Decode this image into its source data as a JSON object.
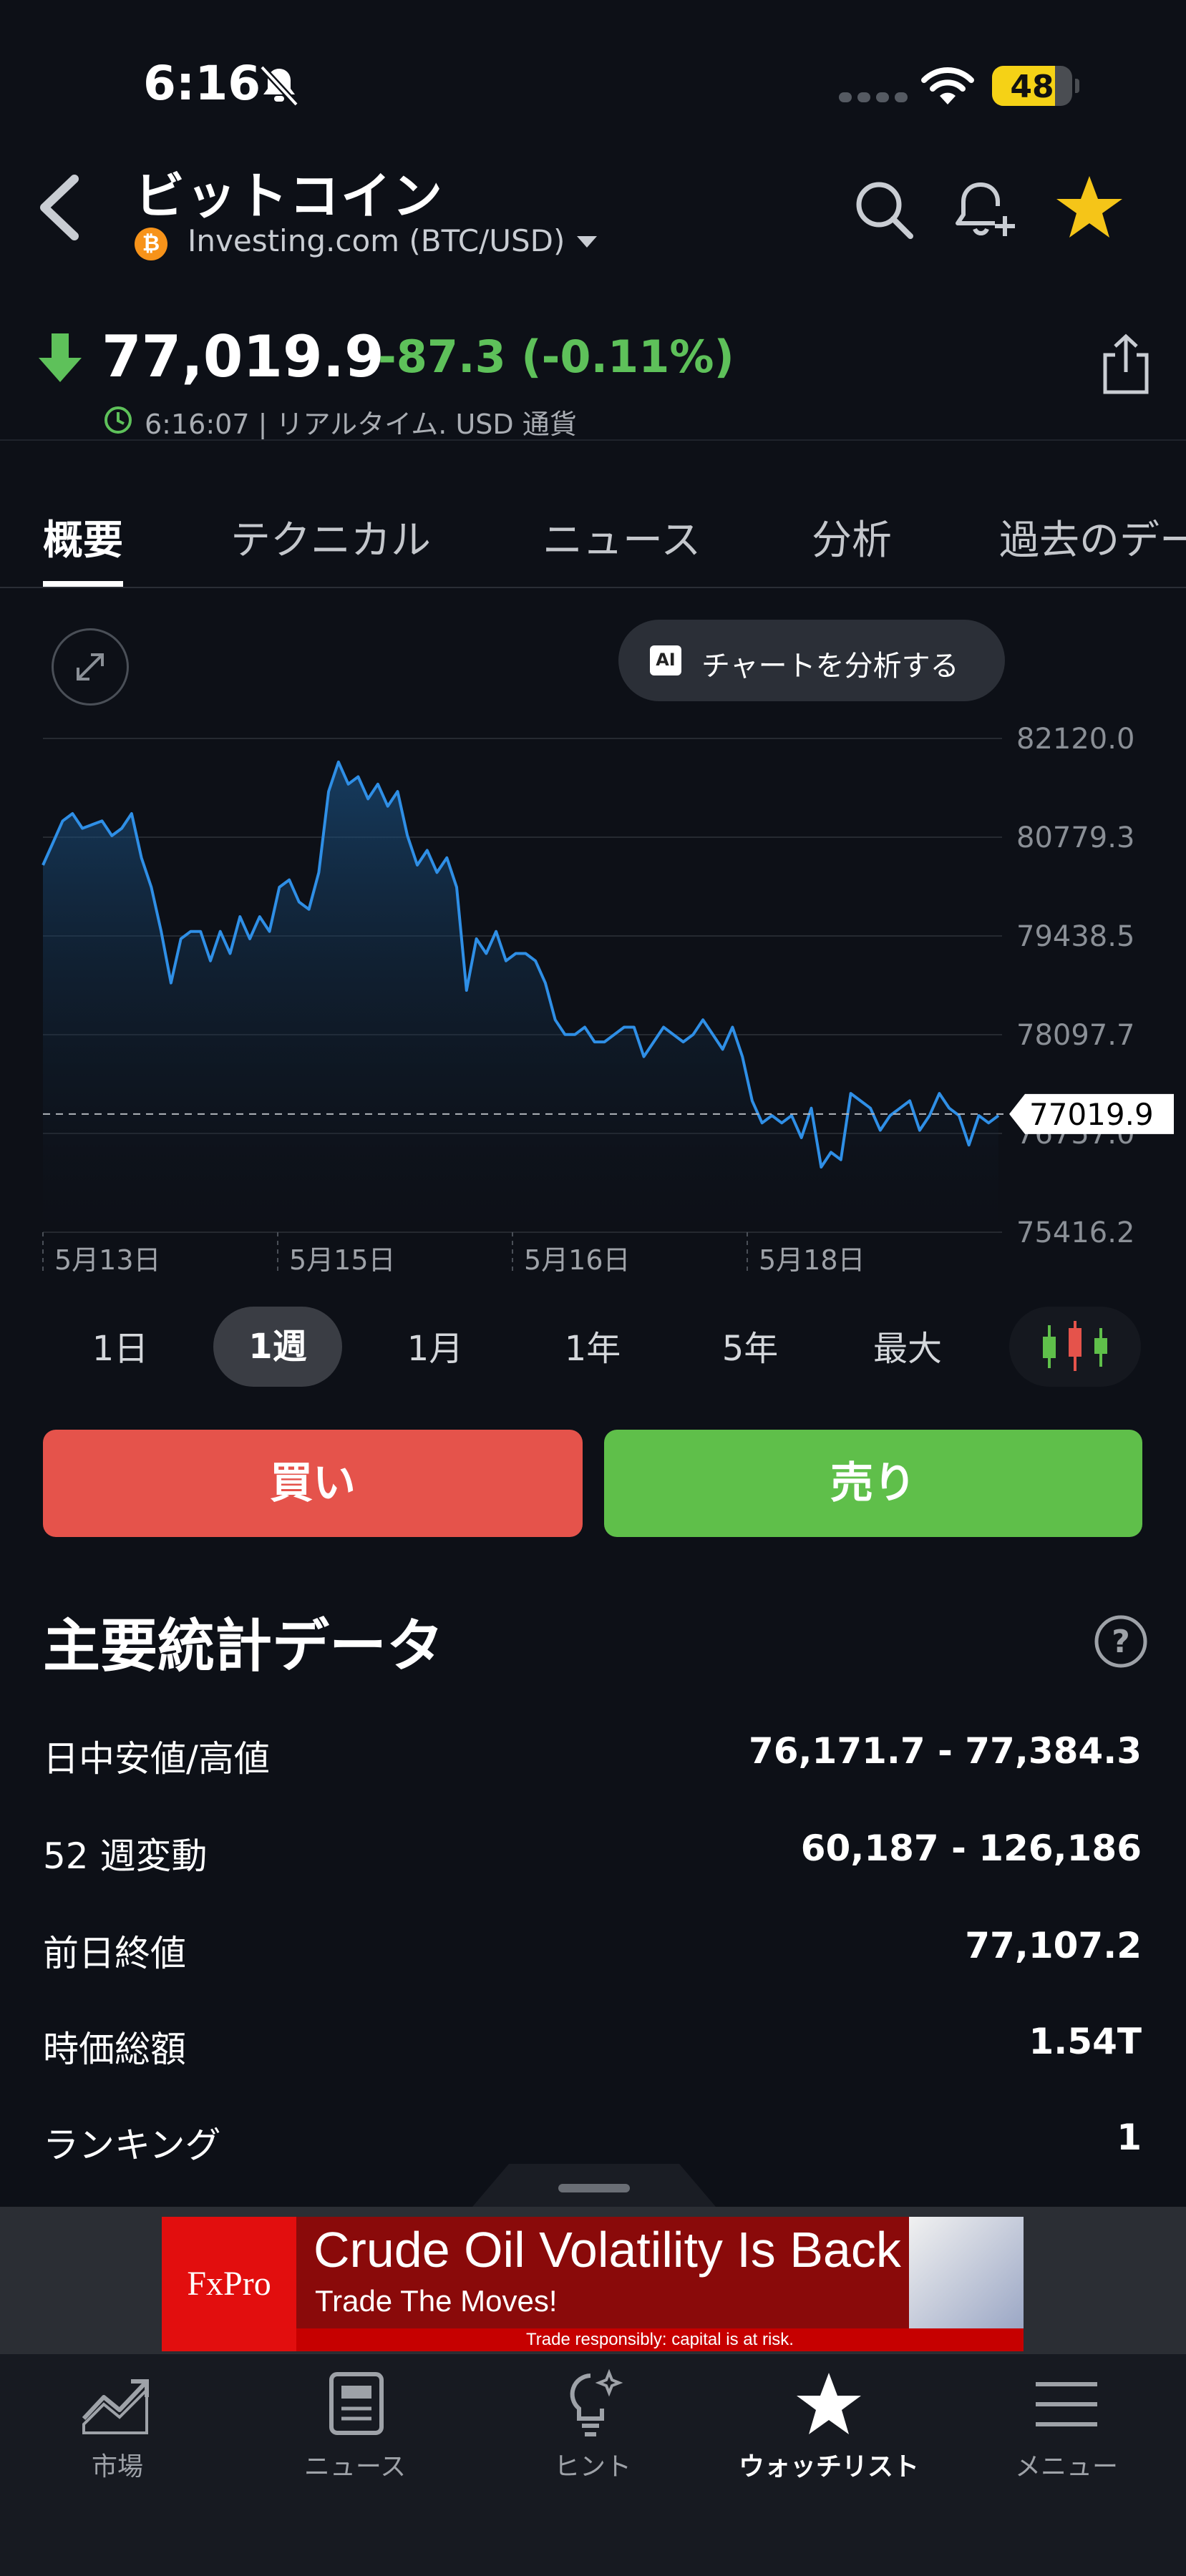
{
  "status_bar": {
    "time": "6:16",
    "battery": "48"
  },
  "header": {
    "title": "ビットコイン",
    "source": "Investing.com (BTC/USD)",
    "btc_symbol": "₿"
  },
  "quote": {
    "price": "77,019.9",
    "change": "-87.3 (-0.11%)",
    "timestamp": "6:16:07 | リアルタイム. USD 通貨"
  },
  "tabs": [
    "概要",
    "テクニカル",
    "ニュース",
    "分析",
    "過去のデー"
  ],
  "chart": {
    "ai_badge": "AI",
    "ai_button": "チャートを分析する",
    "current_label": "77019.9"
  },
  "chart_data": {
    "type": "area",
    "x_ticks": [
      "5月13日",
      "5月15日",
      "5月16日",
      "5月18日"
    ],
    "y_ticks": [
      "82120.0",
      "80779.3",
      "79438.5",
      "78097.7",
      "76757.0",
      "75416.2"
    ],
    "ylim": [
      75416.2,
      82120.0
    ],
    "current_value": 77019.9,
    "values": [
      80400,
      80700,
      81000,
      81100,
      80900,
      80950,
      81000,
      80800,
      80900,
      81100,
      80500,
      80100,
      79500,
      78800,
      79400,
      79500,
      79500,
      79100,
      79500,
      79200,
      79700,
      79400,
      79700,
      79500,
      80100,
      80200,
      79900,
      79800,
      80300,
      81400,
      81800,
      81500,
      81600,
      81300,
      81500,
      81200,
      81400,
      80800,
      80400,
      80600,
      80300,
      80500,
      80100,
      78700,
      79400,
      79200,
      79500,
      79100,
      79200,
      79200,
      79100,
      78800,
      78300,
      78100,
      78100,
      78200,
      78000,
      78000,
      78100,
      78200,
      78200,
      77800,
      78000,
      78200,
      78100,
      78000,
      78100,
      78300,
      78100,
      77900,
      78200,
      77800,
      77200,
      76900,
      77000,
      76900,
      77000,
      76700,
      77100,
      76300,
      76500,
      76400,
      77300,
      77200,
      77100,
      76800,
      77000,
      77100,
      77200,
      76800,
      77000,
      77300,
      77100,
      77000,
      76600,
      77000,
      76900,
      77000
    ]
  },
  "periods": [
    "1日",
    "1週",
    "1月",
    "1年",
    "5年",
    "最大"
  ],
  "selected_period": "1週",
  "actions": {
    "buy": "買い",
    "sell": "売り"
  },
  "stats": {
    "title": "主要統計データ",
    "rows": [
      {
        "label": "日中安値/高値",
        "value": "76,171.7 - 77,384.3"
      },
      {
        "label": "52 週変動",
        "value": "60,187 - 126,186"
      },
      {
        "label": "前日終値",
        "value": "77,107.2"
      },
      {
        "label": "時価総額",
        "value": "1.54T"
      },
      {
        "label": "ランキング",
        "value": "1"
      }
    ]
  },
  "ad": {
    "logo": "FxPro",
    "headline": "Crude Oil Volatility Is Back",
    "subline": "Trade The Moves!",
    "disclaimer": "Trade responsibly: capital is at risk."
  },
  "bottom_nav": [
    {
      "label": "市場",
      "icon": "chart-trend-icon"
    },
    {
      "label": "ニュース",
      "icon": "newspaper-icon"
    },
    {
      "label": "ヒント",
      "icon": "lightbulb-icon"
    },
    {
      "label": "ウォッチリスト",
      "icon": "star-icon"
    },
    {
      "label": "メニュー",
      "icon": "hamburger-icon"
    }
  ],
  "colors": {
    "up": "#5ec15a",
    "down": "#e5534b",
    "line": "#2f8fe6",
    "star": "#f5c518"
  }
}
